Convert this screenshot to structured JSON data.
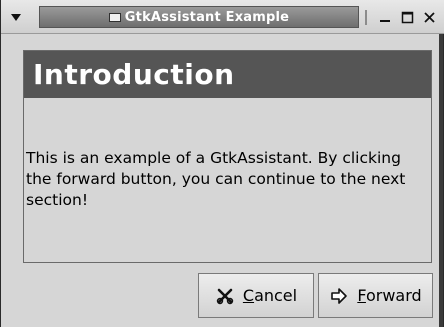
{
  "window": {
    "title": "GtkAssistant Example"
  },
  "page": {
    "title": "Introduction",
    "body": "This is an example of a GtkAssistant. By clicking the forward button, you can continue to the next section!"
  },
  "buttons": {
    "cancel": {
      "mnemonic": "C",
      "rest": "ancel",
      "icon": "cancel-icon"
    },
    "forward": {
      "mnemonic": "F",
      "rest": "orward",
      "icon": "forward-arrow-icon"
    }
  },
  "icons": {
    "window_menu": "down-triangle-icon",
    "minimize": "minimize-icon",
    "maximize": "maximize-icon",
    "close": "close-icon"
  },
  "colors": {
    "header_bg": "#555555",
    "window_bg": "#d6d6d6",
    "titlebar_active": "#7a7a7a"
  }
}
